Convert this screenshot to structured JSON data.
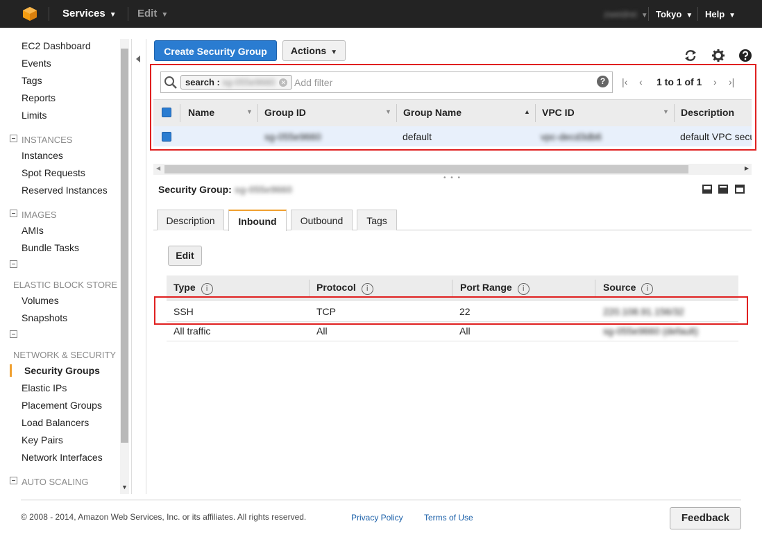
{
  "topbar": {
    "services": "Services",
    "edit": "Edit",
    "user": "zweidrei",
    "region": "Tokyo",
    "help": "Help"
  },
  "sidebar": {
    "items": [
      "EC2 Dashboard",
      "Events",
      "Tags",
      "Reports",
      "Limits"
    ],
    "instances": {
      "header": "INSTANCES",
      "items": [
        "Instances",
        "Spot Requests",
        "Reserved Instances"
      ]
    },
    "images": {
      "header": "IMAGES",
      "items": [
        "AMIs",
        "Bundle Tasks"
      ]
    },
    "ebs": {
      "header": "ELASTIC BLOCK STORE",
      "items": [
        "Volumes",
        "Snapshots"
      ]
    },
    "network": {
      "header": "NETWORK & SECURITY",
      "items": [
        "Security Groups",
        "Elastic IPs",
        "Placement Groups",
        "Load Balancers",
        "Key Pairs",
        "Network Interfaces"
      ]
    },
    "autoscaling": {
      "header": "AUTO SCALING"
    }
  },
  "toolbar": {
    "create_label": "Create Security Group",
    "actions_label": "Actions"
  },
  "filter": {
    "chip_key": "search :",
    "chip_value": "sg-055e9660",
    "placeholder": "Add filter",
    "pagination": "1 to 1 of 1"
  },
  "grid": {
    "columns": [
      "Name",
      "Group ID",
      "Group Name",
      "VPC ID",
      "Description"
    ],
    "row": {
      "name": "",
      "group_id": "sg-055e9660",
      "group_name": "default",
      "vpc_id": "vpc-decd3db6",
      "description": "default VPC secur"
    }
  },
  "details": {
    "title_label": "Security Group:",
    "title_value": "sg-055e9660",
    "tabs": [
      "Description",
      "Inbound",
      "Outbound",
      "Tags"
    ],
    "active_tab": "Inbound",
    "edit_label": "Edit",
    "rules_columns": [
      "Type",
      "Protocol",
      "Port Range",
      "Source"
    ],
    "info_glyph": "i",
    "rules": [
      {
        "type": "SSH",
        "protocol": "TCP",
        "port_range": "22",
        "source": "220.108.91.156/32"
      },
      {
        "type": "All traffic",
        "protocol": "All",
        "port_range": "All",
        "source": "sg-055e9660 (default)"
      }
    ]
  },
  "footer": {
    "copyright": "© 2008 - 2014, Amazon Web Services, Inc. or its affiliates. All rights reserved.",
    "privacy": "Privacy Policy",
    "terms": "Terms of Use",
    "feedback": "Feedback"
  },
  "colors": {
    "accent": "#2a7cd1",
    "topbar": "#232323",
    "highlight": "#e02020",
    "active_tab": "#f0a030"
  }
}
